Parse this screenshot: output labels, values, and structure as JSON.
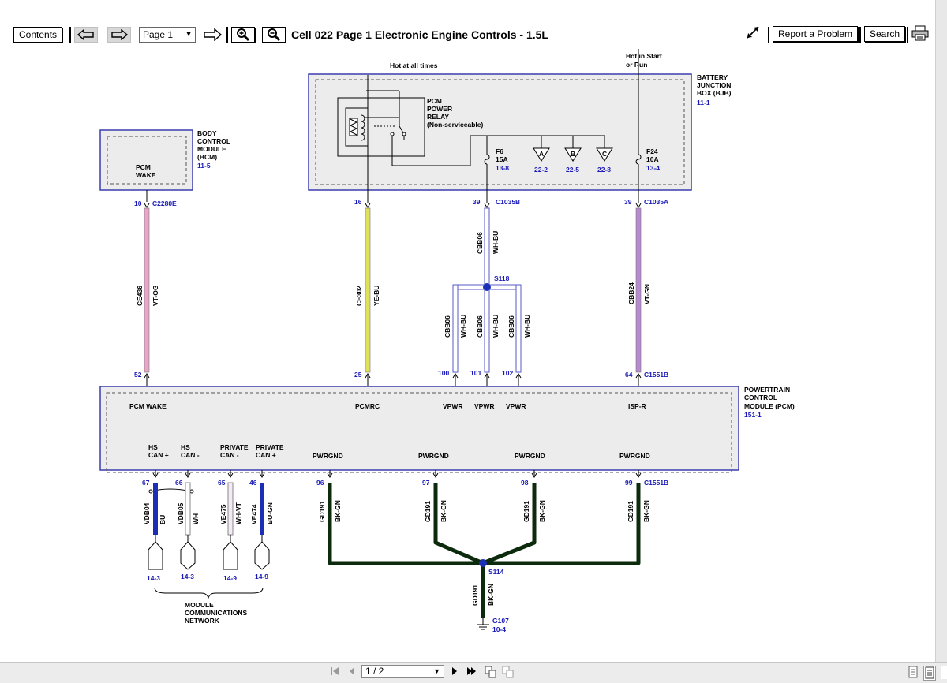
{
  "toolbar": {
    "contents_label": "Contents",
    "page_select_value": "Page 1",
    "title": "Cell 022 Page 1 Electronic Engine Controls - 1.5L",
    "report_label": "Report a Problem",
    "search_label": "Search"
  },
  "bottombar": {
    "page_indicator": "1 / 2"
  },
  "diagram": {
    "hot_at_all_times": "Hot at all times",
    "hot_start_run_1": "Hot in Start",
    "hot_start_run_2": "or Run",
    "bjb_1": "BATTERY",
    "bjb_2": "JUNCTION",
    "bjb_3": "BOX (BJB)",
    "bjb_ref": "11-1",
    "relay_1": "PCM",
    "relay_2": "POWER",
    "relay_3": "RELAY",
    "relay_4": "(Non-serviceable)",
    "f6_name": "F6",
    "f6_amp": "15A",
    "f6_ref": "13-8",
    "f24_name": "F24",
    "f24_amp": "10A",
    "f24_ref": "13-4",
    "tri_a": "A",
    "tri_b": "B",
    "tri_c": "C",
    "tri_a_ref": "22-2",
    "tri_b_ref": "22-5",
    "tri_c_ref": "22-8",
    "bcm_1": "BODY",
    "bcm_2": "CONTROL",
    "bcm_3": "MODULE",
    "bcm_4": "(BCM)",
    "bcm_ref": "11-5",
    "pcm_wake_1": "PCM",
    "pcm_wake_2": "WAKE",
    "pin_10": "10",
    "conn_c2280e": "C2280E",
    "pin_16": "16",
    "pin_39a": "39",
    "conn_c1035b": "C1035B",
    "pin_39b": "39",
    "conn_c1035a": "C1035A",
    "w_ce436": "CE436",
    "c_vtog": "VT-OG",
    "w_ce302": "CE302",
    "c_yebu": "YE-BU",
    "w_cbb06": "CBB06",
    "c_whbu": "WH-BU",
    "w_cbb24": "CBB24",
    "c_vtgn": "VT-GN",
    "s118": "S118",
    "pin_52": "52",
    "pin_25": "25",
    "pin_100": "100",
    "pin_101": "101",
    "pin_102": "102",
    "pin_64": "64",
    "conn_c1551b": "C1551B",
    "pcm_1": "POWERTRAIN",
    "pcm_2": "CONTROL",
    "pcm_3": "MODULE (PCM)",
    "pcm_ref": "151-1",
    "sig_pcm_wake": "PCM WAKE",
    "sig_pcmrc": "PCMRC",
    "sig_vpwr": "VPWR",
    "sig_ispr": "ISP-R",
    "hs": "HS",
    "can_plus": "CAN +",
    "can_minus": "CAN -",
    "private": "PRIVATE",
    "pwrgnd": "PWRGND",
    "pin_67": "67",
    "pin_66": "66",
    "pin_65": "65",
    "pin_46": "46",
    "pin_96": "96",
    "pin_97": "97",
    "pin_98": "98",
    "pin_99": "99",
    "w_vdb04": "VDB04",
    "c_bu": "BU",
    "w_vdb05": "VDB05",
    "c_wh": "WH",
    "w_ve475": "VE475",
    "c_whvt": "WH-VT",
    "w_ve474": "VE474",
    "c_bugn": "BU-GN",
    "w_gd191": "GD191",
    "c_bkgn": "BK-GN",
    "s114": "S114",
    "g107": "G107",
    "g107_ref": "10-4",
    "ref_143": "14-3",
    "ref_149": "14-9",
    "mcn_1": "MODULE",
    "mcn_2": "COMMUNICATIONS",
    "mcn_3": "NETWORK"
  },
  "colors": {
    "wire_pink": "#e9a6c9",
    "wire_yellow": "#e2e05a",
    "wire_violet": "#b98ad0",
    "wire_blue": "#1b2fb6",
    "wire_ground": "#0c2a0c",
    "text_blue": "#1a1ab8",
    "box_border": "#3c3cb0",
    "box_fill": "#ececec"
  }
}
